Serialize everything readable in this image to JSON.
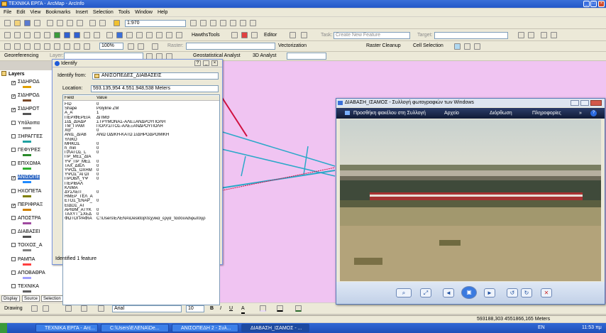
{
  "app": {
    "title": "ΤΕΧΝΙΚΑ ΕΡΓΑ - ArcMap - ArcInfo"
  },
  "menu": [
    "File",
    "Edit",
    "View",
    "Bookmarks",
    "Insert",
    "Selection",
    "Tools",
    "Window",
    "Help"
  ],
  "toolbar": {
    "scale": "1:970",
    "hawths": "HawthsTools",
    "editor": "Editor",
    "task_label": "Task:",
    "task_value": "Create New Feature",
    "target_label": "Target:",
    "zoom_pct": "100%",
    "raster_label": "Raster:",
    "vectorization": "Vectorization",
    "raster_cleanup": "Raster Cleanup",
    "cell_selection": "Cell Selection",
    "georeferencing": "Georeferencing",
    "layer_label": "Layer:",
    "geostat": "Geostatistical Analyst",
    "analyst3d": "3D Analyst"
  },
  "toc": {
    "root": "Layers",
    "items": [
      {
        "label": "ΣΙΔΗΡΟΔ",
        "checked": true,
        "sym": "#e0a000"
      },
      {
        "label": "ΣΙΔΗΡΟΔ",
        "checked": true,
        "sym": "#7a4a2a"
      },
      {
        "label": "ΣΙΔΗΡΟΤ",
        "checked": true,
        "sym": "#555555"
      },
      {
        "label": "Υπόλοιπα",
        "checked": false,
        "sym": "#999999"
      },
      {
        "label": "ΞΗΡΑΓΓΕΣ",
        "checked": false,
        "sym": "#1fa0a0"
      },
      {
        "label": "ΓΕΦΥΡΕΣ",
        "checked": false,
        "sym": "#2a8a2a"
      },
      {
        "label": "ΕΠΙΧΩΜΑ",
        "checked": false,
        "sym": "#2fb02f"
      },
      {
        "label": "ΑΝΙΣΟΠΕ",
        "checked": true,
        "sym": "#1f8aff",
        "selected": true
      },
      {
        "label": "ΗΧΟΠΕΤΑ",
        "checked": false,
        "sym": "#7f7f00"
      },
      {
        "label": "ΠΕΡΙΦΡΑΞ",
        "checked": true,
        "sym": "#d08000"
      },
      {
        "label": "ΑΠΟΣΤΡΑ",
        "checked": false,
        "sym": "#a04aa0"
      },
      {
        "label": "ΔΙΑΒΑΣΕΙ",
        "checked": false,
        "sym": "#505050"
      },
      {
        "label": "ΤΟΙΧΟΣ_Α",
        "checked": false,
        "sym": "#808080"
      },
      {
        "label": "ΡΑΜΠΑ",
        "checked": false,
        "sym": "#ff4040"
      },
      {
        "label": "ΑΠΟΒΑΘΡΑ",
        "checked": false,
        "sym": "#a0a0ff"
      },
      {
        "label": "ΤΕΧΝΙΚΑ",
        "checked": false,
        "sym": "#606060"
      }
    ],
    "tabs": [
      "Display",
      "Source",
      "Selection"
    ]
  },
  "identify": {
    "title": "Identify",
    "from_label": "Identify from:",
    "from_value": "ΑΝΙΣΟΠΕΔΕΣ_ΔΙΑΒΑΣΕΙΣ",
    "location_label": "Location:",
    "location_value": "593.135,954  4.551.948,538 Meters",
    "col_field": "Field",
    "col_value": "Value",
    "rows": [
      [
        "FID",
        "0"
      ],
      [
        "Shape",
        "Polyline ZM"
      ],
      [
        "A_A",
        "1"
      ],
      [
        "ΠΕΡΙΦΕΡΕΙΑ",
        "ΔΠΜΘ"
      ],
      [
        "ΣΙΔ_ΔΙΑΔΡ",
        "ΣΤΡΥΜΟΝΑΣ-ΑΛΕΞΑΝΔΡΟΥΠΟΛΗ"
      ],
      [
        "ΤΜ_ΓΡΑΜ",
        "ΠΟΛΥΣΙΤΟΣ-ΑΛΕΞΑΝΔΡΟΥΠΟΛΗ"
      ],
      [
        "ΧΘ",
        "0"
      ],
      [
        "ΑΝΙΣ_ΔΙΑΒ",
        "ΑΝΩ ΟΔΙΚΗ-ΚΑΤΩ ΣΙΔΗΡΟΔΡΟΜΙΚΗ"
      ],
      [
        "ΥΛΙΚΟ",
        ""
      ],
      [
        "ΜΗΚΟΣ",
        "0"
      ],
      [
        "h_min",
        "0"
      ],
      [
        "ΠΛΑΤΟΣ_L",
        "0"
      ],
      [
        "ΠΡ_ΜΕΣ_ΔΙΑ",
        ""
      ],
      [
        "ΥΨ_ΠΡ_ΜΕΣ",
        "0"
      ],
      [
        "ΤΑΧ_ΔΙΕΛ",
        "0"
      ],
      [
        "ΥΨΟΣ_ΟΧΗΜ",
        "0"
      ],
      [
        "ΥΨΟΣ_ΑΓΩΓ",
        "0"
      ],
      [
        "ΠΡΟΒΛ_ΥΨ",
        "0"
      ],
      [
        "ΠΕΡΙΒΑΛ",
        ""
      ],
      [
        "ΚΛΙΜΑ",
        ""
      ],
      [
        "ΔΥΣΛΕΙΤ_",
        "0"
      ],
      [
        "ΗΜΕΡ_ΤΕΛ_Α",
        ""
      ],
      [
        "ΕΤΟΣ_ΕΝΑΡ_",
        "0"
      ],
      [
        "ΕΙΔΟΣ_ΑΤ",
        ""
      ],
      [
        "ΑΡΙΘΜ_ΑΤΥΚ",
        "0"
      ],
      [
        "ΤΑΧΥΤ_ΣΧΕΔ",
        "0"
      ],
      [
        "ΦΩΤΟΓΡΑΦΙΑ",
        "C:\\Users\\ΕΛΕΝΑ\\Desktop\\τεχνικα_εργα_τασουλα\\φωτογρ"
      ]
    ],
    "status": "Identified 1 feature"
  },
  "photo": {
    "title": "ΔΙΑΒΑΣΗ_ΙΣΑΜΟΣ - Συλλογή φωτογραφιών των Windows",
    "menu": [
      "Προσθήκη φακέλου στη Συλλογή",
      "Αρχείο",
      "Διόρθωση",
      "Πληροφορίες"
    ]
  },
  "status": {
    "coords": "593188,303  4551866,165 Meters"
  },
  "drawing": {
    "label": "Drawing",
    "font": "Arial",
    "size": "10"
  },
  "taskbar": {
    "tasks": [
      "ΤΕΧΝΙΚΑ ΕΡΓΑ - Arc...",
      "C:\\Users\\ΕΛΕΝΑ\\De...",
      "ΑΝΙΣΟΠΕΔΗ 2 - Συλ...",
      "ΔΙΑΒΑΣΗ_ΙΣΑΜΟΣ - ..."
    ],
    "lang": "EN",
    "clock": "11:53 πμ"
  },
  "colors": {
    "map_bg": "#f0c4f2",
    "feature_cyan": "#2aa8c8",
    "feature_red": "#d01040",
    "selection_blue": "#316ac5"
  }
}
